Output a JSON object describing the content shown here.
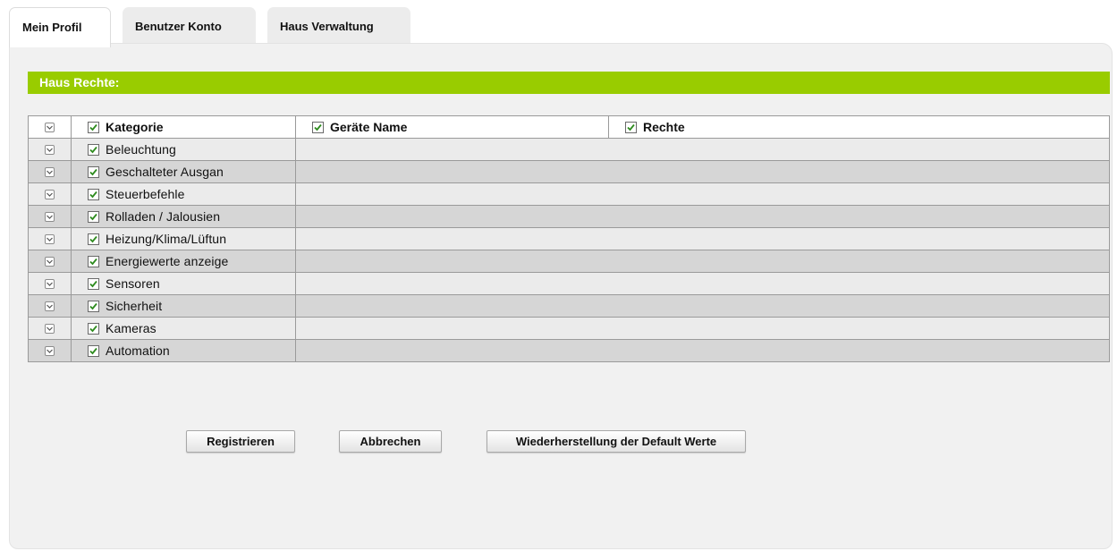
{
  "tabs": [
    {
      "label": "Mein Profil",
      "active": true
    },
    {
      "label": "Benutzer Konto",
      "active": false
    },
    {
      "label": "Haus Verwaltung",
      "active": false
    }
  ],
  "section": {
    "title": "Haus Rechte:"
  },
  "table": {
    "headers": {
      "category": "Kategorie",
      "device_name": "Geräte Name",
      "rights": "Rechte"
    },
    "rows": [
      {
        "category": "Beleuchtung",
        "checked": true
      },
      {
        "category": "Geschalteter Ausgan",
        "checked": true
      },
      {
        "category": "Steuerbefehle",
        "checked": true
      },
      {
        "category": "Rolladen / Jalousien",
        "checked": true
      },
      {
        "category": "Heizung/Klima/Lüftun",
        "checked": true
      },
      {
        "category": "Energiewerte anzeige",
        "checked": true
      },
      {
        "category": "Sensoren",
        "checked": true
      },
      {
        "category": "Sicherheit",
        "checked": true
      },
      {
        "category": "Kameras",
        "checked": true
      },
      {
        "category": "Automation",
        "checked": true
      }
    ]
  },
  "buttons": {
    "register": "Registrieren",
    "cancel": "Abbrechen",
    "reset_defaults": "Wiederherstellung der Default Werte"
  },
  "icons": {
    "expand": "chevron-down-icon",
    "checkbox": "checkbox-checked-icon"
  },
  "colors": {
    "accent_green": "#99cc00",
    "checkmark_green": "#2e8b1e",
    "row_light": "#ebebeb",
    "row_dark": "#d6d6d6"
  }
}
